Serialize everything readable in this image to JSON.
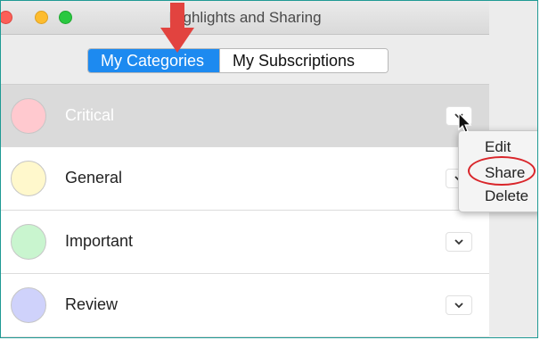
{
  "window": {
    "title": "Highlights and Sharing"
  },
  "segments": [
    {
      "label": "My Categories",
      "selected": true
    },
    {
      "label": "My Subscriptions",
      "selected": false
    }
  ],
  "categories": [
    {
      "name": "Critical",
      "color": "#ffc9cf",
      "selected": true
    },
    {
      "name": "General",
      "color": "#fff8cc",
      "selected": false
    },
    {
      "name": "Important",
      "color": "#c9f5cf",
      "selected": false
    },
    {
      "name": "Review",
      "color": "#cfd2fb",
      "selected": false
    }
  ],
  "context_menu": {
    "items": [
      "Edit",
      "Share",
      "Delete"
    ],
    "highlighted": "Share"
  },
  "annotations": {
    "arrow_color": "#e2433f",
    "circle_color": "#d9252a"
  }
}
